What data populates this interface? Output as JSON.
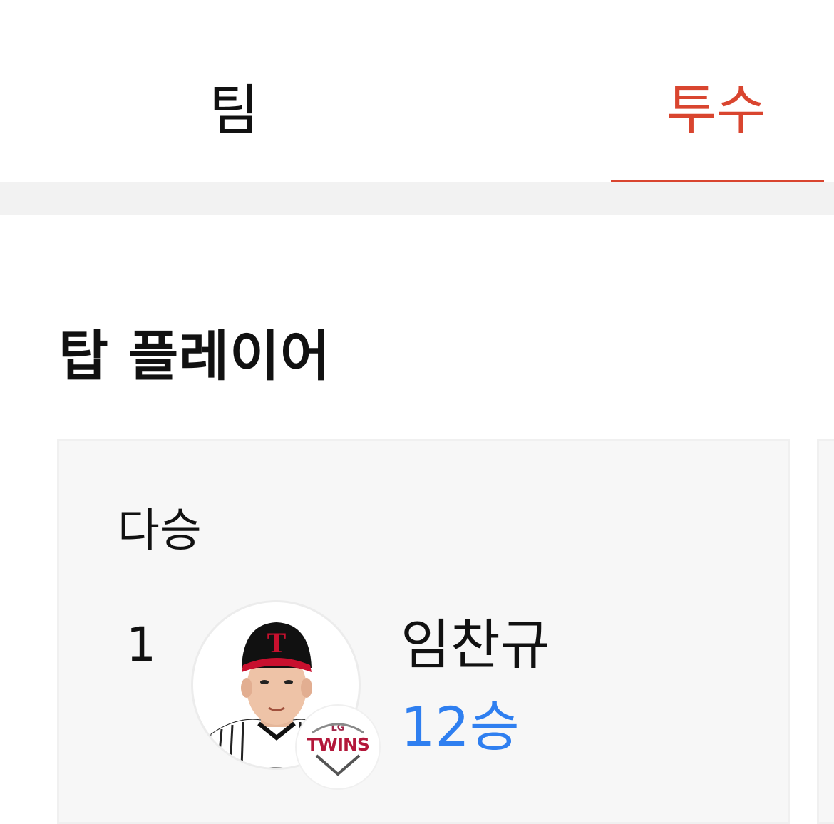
{
  "tabs": [
    {
      "label": "팀",
      "active": false
    },
    {
      "label": "투수",
      "active": true
    }
  ],
  "accent_color": "#d9452f",
  "section": {
    "title": "탑 플레이어"
  },
  "card": {
    "title": "다승",
    "player": {
      "rank": "1",
      "name": "임찬규",
      "stat": "12승",
      "team_logo": {
        "top_text": "LG",
        "main_text": "TWINS"
      }
    }
  }
}
